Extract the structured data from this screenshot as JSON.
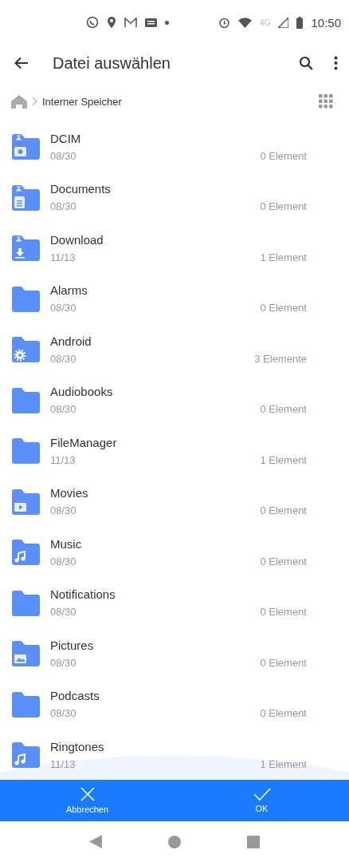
{
  "status_bar": {
    "time": "10:50",
    "network": "4G"
  },
  "toolbar": {
    "title": "Datei auswählen"
  },
  "breadcrumb": {
    "path": "Interner Speicher"
  },
  "folders": [
    {
      "name": "DCIM",
      "date": "08/30",
      "count": "0 Element",
      "kind": "camera"
    },
    {
      "name": "Documents",
      "date": "08/30",
      "count": "0 Element",
      "kind": "document"
    },
    {
      "name": "Download",
      "date": "11/13",
      "count": "1 Element",
      "kind": "download"
    },
    {
      "name": "Alarms",
      "date": "08/30",
      "count": "0 Element",
      "kind": "plain"
    },
    {
      "name": "Android",
      "date": "08/30",
      "count": "3 Elemente",
      "kind": "gear"
    },
    {
      "name": "Audiobooks",
      "date": "08/30",
      "count": "0 Element",
      "kind": "plain"
    },
    {
      "name": "FileManager",
      "date": "11/13",
      "count": "1 Element",
      "kind": "plain"
    },
    {
      "name": "Movies",
      "date": "08/30",
      "count": "0 Element",
      "kind": "video"
    },
    {
      "name": "Music",
      "date": "08/30",
      "count": "0 Element",
      "kind": "music"
    },
    {
      "name": "Notifications",
      "date": "08/30",
      "count": "0 Element",
      "kind": "plain"
    },
    {
      "name": "Pictures",
      "date": "08/30",
      "count": "0 Element",
      "kind": "image"
    },
    {
      "name": "Podcasts",
      "date": "08/30",
      "count": "0 Element",
      "kind": "plain"
    },
    {
      "name": "Ringtones",
      "date": "11/13",
      "count": "1 Element",
      "kind": "music"
    }
  ],
  "actions": [
    {
      "label": "Abbrechen",
      "kind": "cancel"
    },
    {
      "label": "OK",
      "kind": "ok"
    }
  ]
}
